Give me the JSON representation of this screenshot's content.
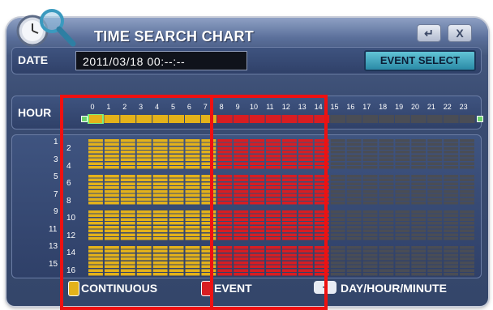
{
  "window": {
    "title": "TIME SEARCH CHART",
    "back_icon": "↵",
    "close_icon": "X"
  },
  "date": {
    "label": "DATE",
    "value": "2011/03/18 00:--:--"
  },
  "event_select": {
    "label": "EVENT SELECT"
  },
  "hour_bar": {
    "label": "HOUR",
    "hours": [
      "0",
      "1",
      "2",
      "3",
      "4",
      "5",
      "6",
      "7",
      "8",
      "9",
      "10",
      "11",
      "12",
      "13",
      "14",
      "15",
      "16",
      "17",
      "18",
      "19",
      "20",
      "21",
      "22",
      "23"
    ]
  },
  "channels": {
    "left_labels": [
      "1",
      "3",
      "5",
      "7",
      "9",
      "11",
      "13",
      "15"
    ],
    "right_labels": [
      "2",
      "4",
      "6",
      "8",
      "10",
      "12",
      "14",
      "16"
    ]
  },
  "recording": {
    "continuous_hours": [
      0,
      1,
      2,
      3,
      4,
      5,
      6,
      7
    ],
    "event_hours": [
      8,
      9,
      10,
      11,
      12,
      13,
      14
    ],
    "colors": {
      "continuous": "#e4b21a",
      "event": "#d81d22",
      "none": "#4a4d55",
      "highlight": "#ee1111"
    }
  },
  "legend": {
    "continuous": "CONTINUOUS",
    "event": "EVENT",
    "zoom": "DAY/HOUR/MINUTE",
    "zoom_icon": "+"
  }
}
